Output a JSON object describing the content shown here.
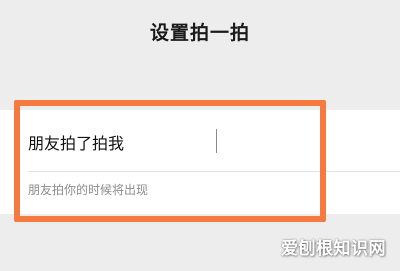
{
  "page": {
    "title": "设置拍一拍"
  },
  "pat_setting": {
    "input_value": "朋友拍了拍我",
    "hint": "朋友拍你的时候将出现"
  },
  "watermark": {
    "text": "爱刨根知识网"
  },
  "colors": {
    "highlight": "#f47a3f",
    "background": "#ededed",
    "card": "#ffffff"
  }
}
